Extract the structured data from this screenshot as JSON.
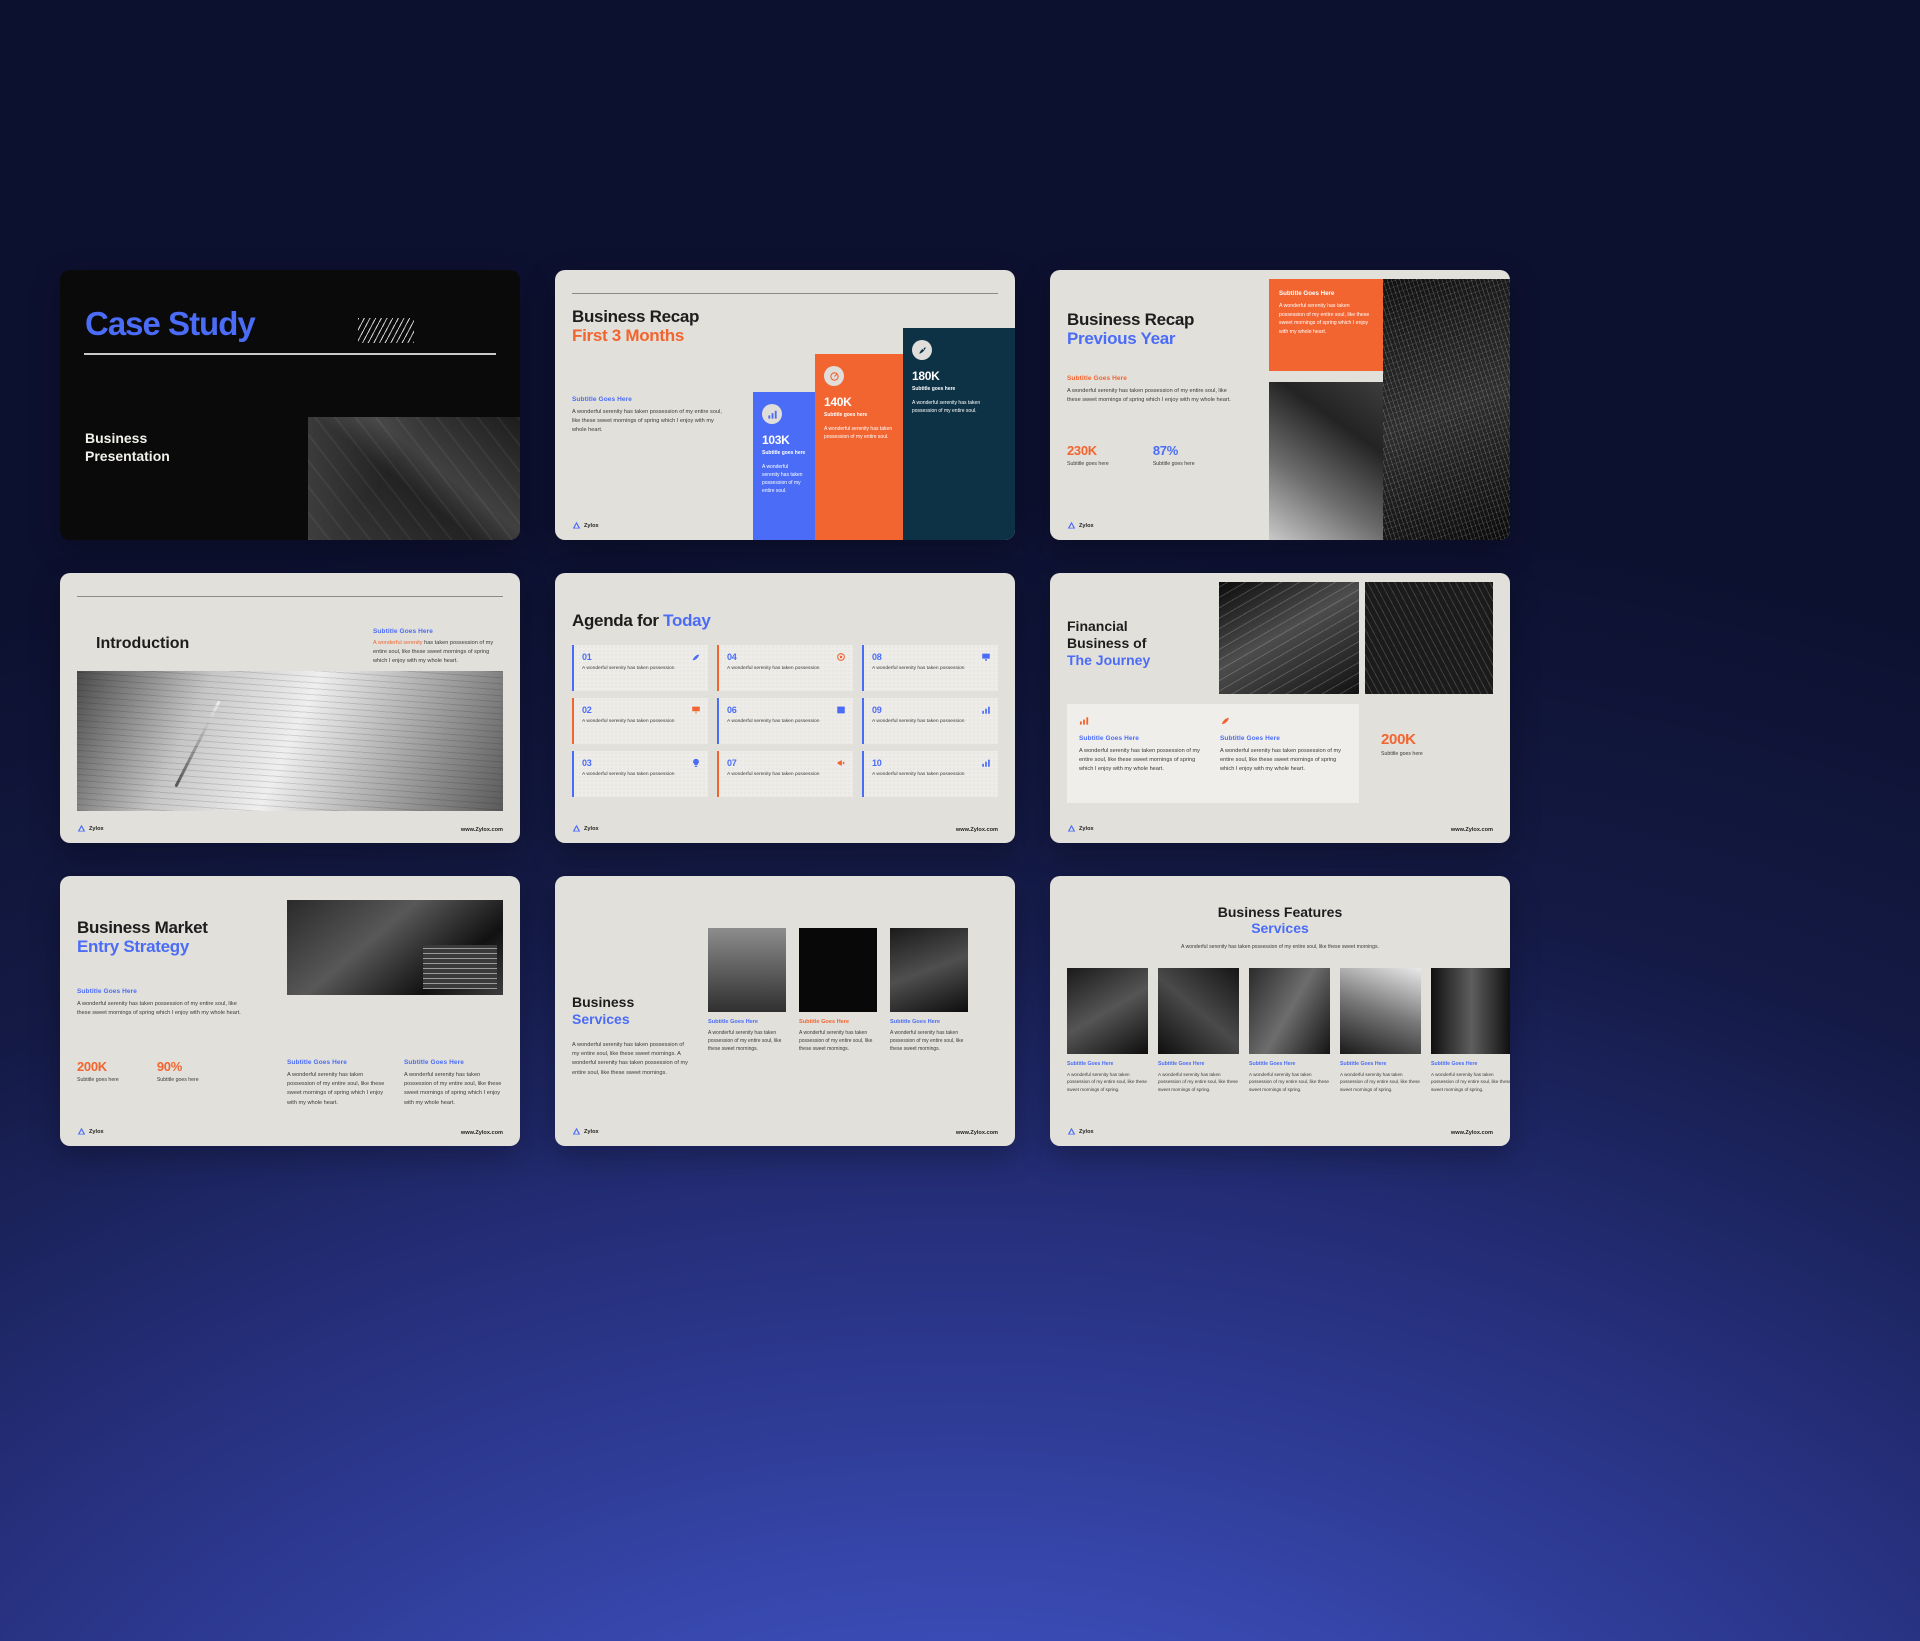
{
  "brand": {
    "name": "Zylox",
    "website": "www.Zylox.com",
    "colors": {
      "blue": "#4a6cf7",
      "orange": "#f26430",
      "navy": "#0d3245",
      "paper": "#e2e0da",
      "ink": "#1d1d1d"
    }
  },
  "lorem": {
    "full": "A wonderful serenity has taken possession of my entire soul, like these sweet mornings of spring which I enjoy with my whole heart.",
    "short": "A wonderful serenity has taken possession of my entire soul.",
    "mid": "A wonderful serenity has taken possession of my entire soul, like these sweet mornings.",
    "tiny": "A wonderful serenity has taken possession",
    "agenda": "A wonderful serenity has taken possession",
    "services": "A wonderful serenity has taken possession of my entire soul, like these sweet mornings.",
    "features": "A wonderful serenity has taken possession of my entire soul, like these sweet mornings of spring.",
    "business": "A wonderful serenity has taken possession of my entire soul, like these sweet mornings. A wonderful serenity has taken possession of my entire soul, like these sweet mornings."
  },
  "labels": {
    "subtitle_goes_here": "Subtitle Goes Here",
    "subtitle_goes_here_lc": "Subtitle goes here"
  },
  "slides": [
    {
      "id": "cover",
      "title": "Case Study",
      "subtitle_line1": "Business",
      "subtitle_line2": "Presentation"
    },
    {
      "id": "recap-first-3-months",
      "title_main": "Business Recap",
      "title_accent": "First 3 Months",
      "subtitle": "Subtitle Goes Here",
      "body": "A wonderful serenity has taken possession of my entire soul, like these sweet mornings of spring which I enjoy with my whole heart.",
      "stats": [
        {
          "value": "103K",
          "label": "Subtitle goes here",
          "body": "A wonderful serenity has taken possession of my entire soul.",
          "color": "#4a6cf7",
          "icon": "bar-chart-icon"
        },
        {
          "value": "140K",
          "label": "Subtitle goes here",
          "body": "A wonderful serenity has taken possession of my entire soul.",
          "color": "#f26430",
          "icon": "target-growth-icon"
        },
        {
          "value": "180K",
          "label": "Subtitle goes here",
          "body": "A wonderful serenity has taken possession of my entire soul.",
          "color": "#0d3245",
          "icon": "rocket-icon"
        }
      ]
    },
    {
      "id": "recap-previous-year",
      "title_main": "Business Recap",
      "title_accent": "Previous Year",
      "subtitle": "Subtitle Goes Here",
      "body": "A wonderful serenity has taken possession of my entire soul, like these sweet mornings of spring which I enjoy with my whole heart.",
      "callout_title": "Subtitle Goes Here",
      "callout_body": "A wonderful serenity has taken possession of my entire soul, like these sweet mornings of spring which I enjoy with my whole heart.",
      "stats": [
        {
          "value": "230K",
          "label": "Subtitle goes here"
        },
        {
          "value": "87%",
          "label": "Subtitle goes here"
        }
      ]
    },
    {
      "id": "introduction",
      "title": "Introduction",
      "subtitle": "Subtitle Goes Here",
      "lead": "A wonderful serenity",
      "body": " has taken possession of my entire soul, like these sweet mornings of spring which I enjoy with my whole heart."
    },
    {
      "id": "agenda",
      "title_main": "Agenda for",
      "title_accent": "Today",
      "items": [
        {
          "num": "01",
          "text": "A wonderful serenity has taken possession",
          "icon": "rocket-icon",
          "accent": "blue"
        },
        {
          "num": "04",
          "text": "A wonderful serenity has taken possession",
          "icon": "target-icon",
          "accent": "orange"
        },
        {
          "num": "08",
          "text": "A wonderful serenity has taken possession",
          "icon": "presentation-icon",
          "accent": "blue"
        },
        {
          "num": "02",
          "text": "A wonderful serenity has taken possession",
          "icon": "board-icon",
          "accent": "orange"
        },
        {
          "num": "06",
          "text": "A wonderful serenity has taken possession",
          "icon": "browser-icon",
          "accent": "blue"
        },
        {
          "num": "09",
          "text": "A wonderful serenity has taken possession",
          "icon": "chart-up-icon",
          "accent": "blue"
        },
        {
          "num": "03",
          "text": "A wonderful serenity has taken possession",
          "icon": "lightbulb-icon",
          "accent": "blue"
        },
        {
          "num": "07",
          "text": "A wonderful serenity has taken possession",
          "icon": "megaphone-icon",
          "accent": "orange"
        },
        {
          "num": "10",
          "text": "A wonderful serenity has taken possession",
          "icon": "bar-chart-icon",
          "accent": "blue"
        }
      ]
    },
    {
      "id": "financial",
      "title_line1": "Financial",
      "title_line2": "Business of",
      "title_accent": "The Journey",
      "columns": [
        {
          "icon": "chart-up-icon",
          "title": "Subtitle Goes Here",
          "body": "A wonderful serenity has taken possession of my entire soul, like these sweet mornings of spring which I enjoy with my whole heart."
        },
        {
          "icon": "rocket-icon",
          "title": "Subtitle Goes Here",
          "body": "A wonderful serenity has taken possession of my entire soul, like these sweet mornings of spring which I enjoy with my whole heart."
        }
      ],
      "stat": {
        "value": "200K",
        "label": "Subtitle goes here"
      }
    },
    {
      "id": "market-entry",
      "title_main": "Business Market",
      "title_accent": "Entry Strategy",
      "subtitle": "Subtitle Goes Here",
      "body": "A wonderful serenity has taken possession of my entire soul, like these sweet mornings of spring which I enjoy with my whole heart.",
      "stats": [
        {
          "value": "200K",
          "label": "Subtitle goes here",
          "color": "#f26430"
        },
        {
          "value": "90%",
          "label": "Subtitle goes here",
          "color": "#f26430"
        }
      ],
      "columns": [
        {
          "title": "Subtitle Goes Here",
          "body": "A wonderful serenity has taken possession of my entire soul, like these sweet mornings of spring which I enjoy with my whole heart."
        },
        {
          "title": "Subtitle Goes Here",
          "body": "A wonderful serenity has taken possession of my entire soul, like these sweet mornings of spring which I enjoy with my whole heart."
        }
      ]
    },
    {
      "id": "services",
      "title_line1": "Business",
      "title_accent": "Services",
      "body": "A wonderful serenity has taken possession of my entire soul, like these sweet mornings. A wonderful serenity has taken possession of my entire soul, like these sweet mornings.",
      "cards": [
        {
          "title": "Subtitle Goes Here",
          "title_color": "blue",
          "body": "A wonderful serenity has taken possession of my entire soul, like these sweet mornings."
        },
        {
          "title": "Subtitle Goes Here",
          "title_color": "orange",
          "body": "A wonderful serenity has taken possession of my entire soul, like these sweet mornings."
        },
        {
          "title": "Subtitle Goes Here",
          "title_color": "blue",
          "body": "A wonderful serenity has taken possession of my entire soul, like these sweet mornings."
        }
      ]
    },
    {
      "id": "features",
      "title_main": "Business Features",
      "title_accent": "Services",
      "lead": "A wonderful serenity has taken possession of my entire soul, like these sweet mornings.",
      "items": [
        {
          "title": "Subtitle Goes Here",
          "body": "A wonderful serenity has taken possession of my entire soul, like these sweet mornings of spring."
        },
        {
          "title": "Subtitle Goes Here",
          "body": "A wonderful serenity has taken possession of my entire soul, like these sweet mornings of spring."
        },
        {
          "title": "Subtitle Goes Here",
          "body": "A wonderful serenity has taken possession of my entire soul, like these sweet mornings of spring."
        },
        {
          "title": "Subtitle Goes Here",
          "body": "A wonderful serenity has taken possession of my entire soul, like these sweet mornings of spring."
        },
        {
          "title": "Subtitle Goes Here",
          "body": "A wonderful serenity has taken possession of my entire soul, like these sweet mornings of spring."
        }
      ]
    }
  ]
}
